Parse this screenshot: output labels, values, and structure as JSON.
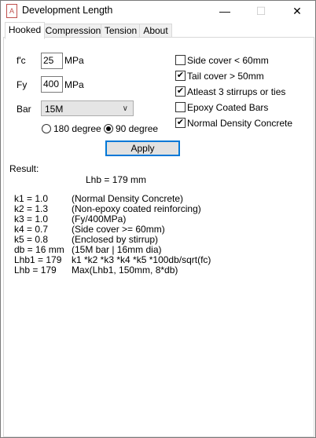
{
  "window": {
    "title": "Development Length",
    "icon_glyph": "A",
    "minimize": "—",
    "maximize": "☐",
    "close": "✕"
  },
  "tabs": [
    {
      "label": "Hooked",
      "active": true
    },
    {
      "label": "Compression",
      "active": false
    },
    {
      "label": "Tension",
      "active": false
    },
    {
      "label": "About",
      "active": false
    }
  ],
  "inputs": {
    "fc_label": "f'c",
    "fc_value": "25",
    "fc_unit": "MPa",
    "fy_label": "Fy",
    "fy_value": "400",
    "fy_unit": "MPa",
    "bar_label": "Bar",
    "bar_value": "15M"
  },
  "hook_angle": {
    "option_180": "180 degree",
    "option_90": "90 degree",
    "selected": "90 degree"
  },
  "checkboxes": [
    {
      "label": "Side cover < 60mm",
      "checked": false
    },
    {
      "label": "Tail cover > 50mm",
      "checked": true
    },
    {
      "label": "Atleast 3 stirrups or ties",
      "checked": true
    },
    {
      "label": "Epoxy Coated Bars",
      "checked": false
    },
    {
      "label": "Normal Density Concrete",
      "checked": true
    }
  ],
  "apply_label": "Apply",
  "result": {
    "heading": "Result:",
    "summary": "Lhb = 179 mm",
    "rows": [
      {
        "name": "k1 = 1.0",
        "note": "(Normal Density Concrete)"
      },
      {
        "name": "k2 = 1.3",
        "note": "(Non-epoxy coated reinforcing)"
      },
      {
        "name": "k3 = 1.0",
        "note": "(Fy/400MPa)"
      },
      {
        "name": "k4 = 0.7",
        "note": "(Side cover >= 60mm)"
      },
      {
        "name": "k5 = 0.8",
        "note": "(Enclosed by stirrup)"
      },
      {
        "name": "db = 16 mm",
        "note": "(15M bar | 16mm dia)"
      },
      {
        "name": "Lhb1 = 179",
        "note": "k1 *k2 *k3 *k4 *k5 *100db/sqrt(fc)"
      },
      {
        "name": "Lhb = 179",
        "note": "Max(Lhb1, 150mm, 8*db)"
      }
    ]
  }
}
